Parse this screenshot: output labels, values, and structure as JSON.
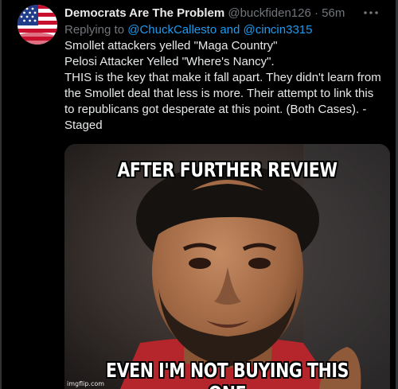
{
  "tweet": {
    "author_name": "Democrats Are The Problem",
    "handle": "@buckfiden126",
    "separator": "·",
    "time": "56m",
    "replying_prefix": "Replying to",
    "reply_user_1": "@ChuckCallesto",
    "reply_and": "and",
    "reply_user_2": "@cincin3315",
    "text_lines": [
      "Smollet attackers yelled \"Maga Country\"",
      "Pelosi Attacker Yelled \"Where's Nancy\".",
      "THIS is the key that make it fall apart. They didn't learn from",
      "the Smollet deal that less is more. Their attempt to link this",
      "to republicans got desperate at this point. (Both Cases).  -",
      "Staged"
    ],
    "avatar_icon": "american-flag-icon",
    "more_icon": "more-options-icon"
  },
  "meme": {
    "top_caption": "AFTER FURTHER REVIEW",
    "bottom_caption": "EVEN  I'M NOT BUYING THIS ONE",
    "watermark": "imgflip.com"
  },
  "colors": {
    "background": "#000000",
    "text": "#e7e9ea",
    "muted": "#71767b",
    "link": "#1d9bf0"
  }
}
